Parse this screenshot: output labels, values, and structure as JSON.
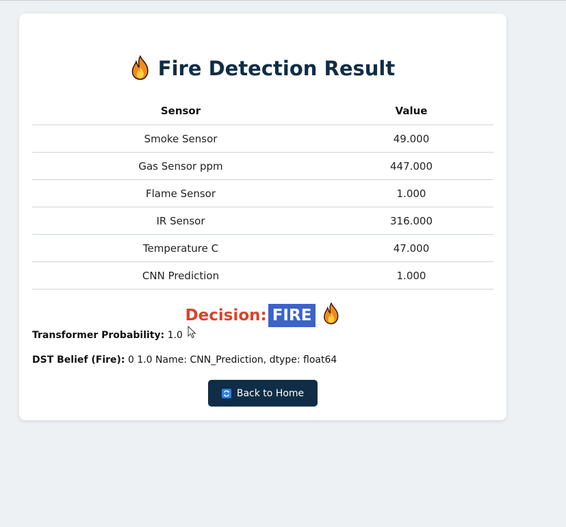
{
  "page": {
    "title": "Fire Detection Result",
    "title_icon": "fire-icon"
  },
  "table": {
    "headers": [
      "Sensor",
      "Value"
    ],
    "rows": [
      {
        "sensor": "Smoke Sensor",
        "value": "49.000"
      },
      {
        "sensor": "Gas Sensor ppm",
        "value": "447.000"
      },
      {
        "sensor": "Flame Sensor",
        "value": "1.000"
      },
      {
        "sensor": "IR Sensor",
        "value": "316.000"
      },
      {
        "sensor": "Temperature C",
        "value": "47.000"
      },
      {
        "sensor": "CNN Prediction",
        "value": "1.000"
      }
    ]
  },
  "decision": {
    "label": "Decision:",
    "value": "FIRE",
    "icon": "fire-icon",
    "label_color": "#d9442a",
    "highlight_color": "#3b63c9"
  },
  "info": {
    "transformer_label": "Transformer Probability:",
    "transformer_value": "1.0",
    "dst_label": "DST Belief (Fire):",
    "dst_value": "0 1.0 Name: CNN_Prediction, dtype: float64"
  },
  "button": {
    "label": "Back to Home",
    "icon": "refresh-icon",
    "color": "#0f2d46"
  }
}
